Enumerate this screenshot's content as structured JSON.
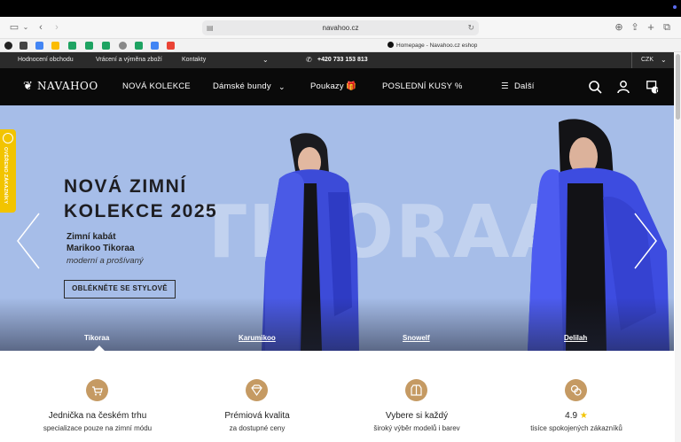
{
  "browser": {
    "url": "navahoo.cz",
    "tab_title": "Homepage - Navahoo.cz eshop"
  },
  "topbar": {
    "links": [
      "Hodnocení obchodu",
      "Vrácení a výměna zboží",
      "Kontakty"
    ],
    "phone": "+420 733 153 813",
    "currency": "CZK"
  },
  "nav": {
    "logo": "NAVAHOO",
    "items": [
      "NOVÁ KOLEKCE",
      "Dámské bundy",
      "Poukazy",
      "POSLEDNÍ KUSY %",
      "Další"
    ],
    "cart_count": "0",
    "icons": [
      "search-icon",
      "user-icon",
      "cart-icon"
    ]
  },
  "badge": {
    "label": "OVĚŘENO ZÁKAZNÍKY"
  },
  "hero": {
    "background_word": "TIKORAA",
    "title_line1": "NOVÁ ZIMNÍ",
    "title_line2": "KOLEKCE 2025",
    "subtitle_line1": "Zimní kabát",
    "subtitle_line2": "Marikoo Tikoraa",
    "tagline": "moderní a prošívaný",
    "cta": "OBLÉKNĚTE SE STYLOVĚ",
    "slides": [
      "Tikoraa",
      "Karumikoo",
      "Snowelf",
      "Delilah"
    ],
    "active_slide": "Tikoraa"
  },
  "features": [
    {
      "title": "Jednička na českém trhu",
      "subtitle": "specializace pouze na zimní módu",
      "icon": "cart-icon"
    },
    {
      "title": "Prémiová kvalita",
      "subtitle": "za dostupné ceny",
      "icon": "diamond-icon"
    },
    {
      "title": "Vybere si každý",
      "subtitle": "široký výběr modelů i barev",
      "icon": "jacket-icon"
    },
    {
      "title": "4.9",
      "subtitle": "tisíce spokojených zákazníků",
      "icon": "star-icon"
    }
  ],
  "colors": {
    "accent": "#c59a63",
    "hero_bg": "#a6bde8",
    "nav_bg": "#0a0a0a",
    "badge": "#f2c400"
  }
}
